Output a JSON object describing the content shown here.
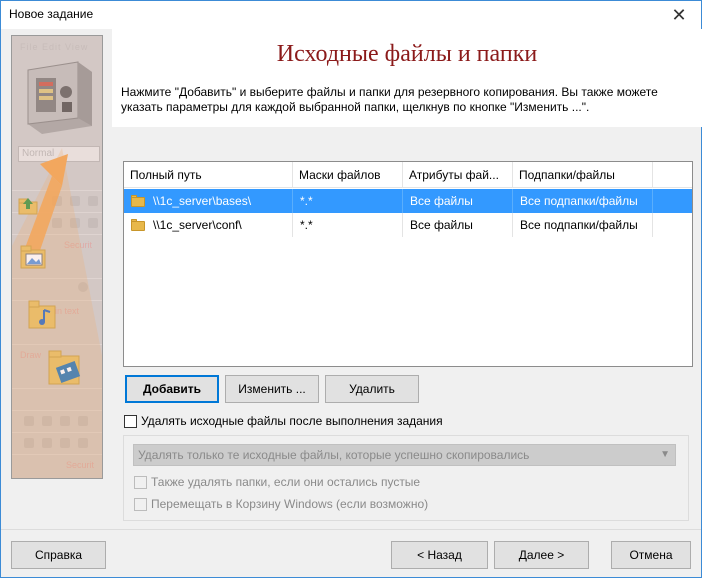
{
  "window": {
    "title": "Новое задание",
    "close_glyph": "✕"
  },
  "left_panel": {
    "menu_ghost": "File  Edit  View",
    "combo_ghost": "Normal",
    "ghost_labels": [
      "Securit",
      "Plain text",
      "Draw",
      "Securit"
    ]
  },
  "header": {
    "title": "Исходные файлы и папки",
    "description": "Нажмите \"Добавить\" и выберите файлы и папки для резервного копирования. Вы также можете указать параметры для каждой выбранной папки, щелкнув по кнопке \"Изменить ...\"."
  },
  "table": {
    "columns": [
      "Полный путь",
      "Маски файлов",
      "Атрибуты фай...",
      "Подпапки/файлы"
    ],
    "rows": [
      {
        "path": "\\\\1c_server\\bases\\",
        "mask": "*.*",
        "attributes": "Все файлы",
        "subfolders": "Все подпапки/файлы",
        "selected": true
      },
      {
        "path": "\\\\1c_server\\conf\\",
        "mask": "*.*",
        "attributes": "Все файлы",
        "subfolders": "Все подпапки/файлы",
        "selected": false
      }
    ]
  },
  "actions": {
    "add": "Добавить",
    "edit": "Изменить ...",
    "delete": "Удалить"
  },
  "options": {
    "delete_sources": "Удалять исходные файлы после выполнения задания",
    "delete_mode": "Удалять только те исходные файлы, которые успешно скопировались",
    "delete_empty_folders": "Также удалять папки, если они остались пустые",
    "move_to_recycle": "Перемещать в Корзину Windows (если возможно)"
  },
  "footer": {
    "help": "Справка",
    "back": "< Назад",
    "next": "Далее >",
    "cancel": "Отмена"
  },
  "colors": {
    "title_red": "#8b1a1a",
    "selection_blue": "#3399ff",
    "focus_blue": "#0078d7",
    "arrow_orange": "#f39a3a"
  }
}
